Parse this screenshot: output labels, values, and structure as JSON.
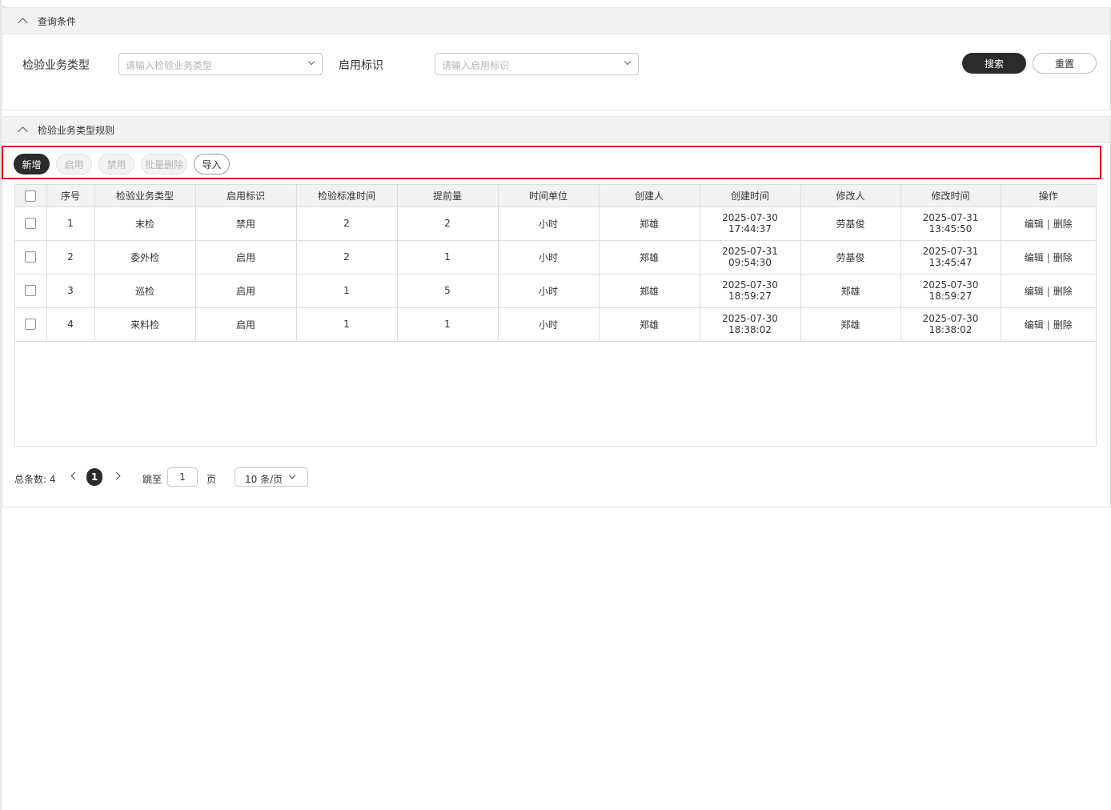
{
  "query_panel": {
    "title": "查询条件",
    "fields": [
      {
        "label": "检验业务类型",
        "placeholder": "请输入检验业务类型"
      },
      {
        "label": "启用标识",
        "placeholder": "请输入启用标识"
      }
    ],
    "search_label": "搜索",
    "reset_label": "重置"
  },
  "rules_panel": {
    "title": "检验业务类型规则",
    "toolbar": {
      "add": "新增",
      "enable": "启用",
      "disable": "禁用",
      "batch_delete": "批量删除",
      "import": "导入"
    },
    "columns": [
      "序号",
      "检验业务类型",
      "启用标识",
      "检验标准时间",
      "提前量",
      "时间单位",
      "创建人",
      "创建时间",
      "修改人",
      "修改时间",
      "操作"
    ],
    "rows": [
      {
        "seq": "1",
        "type": "末检",
        "flag": "禁用",
        "std_time": "2",
        "lead": "2",
        "unit": "小时",
        "creator": "郑雄",
        "created": "2025-07-30 17:44:37",
        "modifier": "劳基俊",
        "modified": "2025-07-31 13:45:50"
      },
      {
        "seq": "2",
        "type": "委外检",
        "flag": "启用",
        "std_time": "2",
        "lead": "1",
        "unit": "小时",
        "creator": "郑雄",
        "created": "2025-07-31 09:54:30",
        "modifier": "劳基俊",
        "modified": "2025-07-31 13:45:47"
      },
      {
        "seq": "3",
        "type": "巡检",
        "flag": "启用",
        "std_time": "1",
        "lead": "5",
        "unit": "小时",
        "creator": "郑雄",
        "created": "2025-07-30 18:59:27",
        "modifier": "郑雄",
        "modified": "2025-07-30 18:59:27"
      },
      {
        "seq": "4",
        "type": "来料检",
        "flag": "启用",
        "std_time": "1",
        "lead": "1",
        "unit": "小时",
        "creator": "郑雄",
        "created": "2025-07-30 18:38:02",
        "modifier": "郑雄",
        "modified": "2025-07-30 18:38:02"
      }
    ],
    "row_actions": {
      "edit": "编辑",
      "sep": "|",
      "delete": "删除"
    }
  },
  "pagination": {
    "total_label": "总条数:",
    "total": "4",
    "current_page": "1",
    "jump_label": "跳至",
    "jump_value": "1",
    "page_label": "页",
    "page_size": "10 条/页"
  },
  "icons": [
    "chevron-up-icon",
    "chevron-down-icon",
    "chevron-left-icon",
    "chevron-right-icon",
    "checkbox-icon"
  ],
  "colors": {
    "primary_dark": "#2b2b2b",
    "highlight_border": "#e0131a",
    "header_bg": "#f2f2f2"
  }
}
